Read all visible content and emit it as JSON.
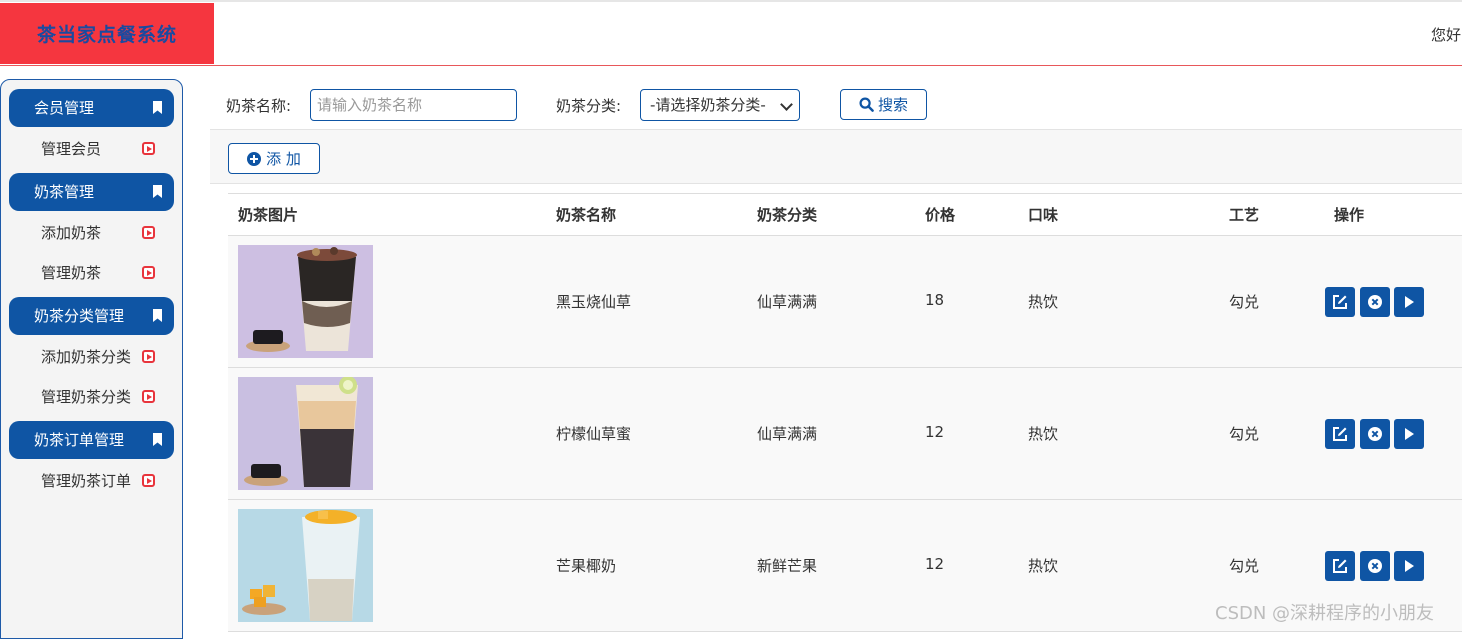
{
  "app": {
    "title": "茶当家点餐系统",
    "greeting": "您好"
  },
  "sidebar": {
    "groups": [
      {
        "title": "会员管理",
        "items": [
          "管理会员"
        ]
      },
      {
        "title": "奶茶管理",
        "items": [
          "添加奶茶",
          "管理奶茶"
        ]
      },
      {
        "title": "奶茶分类管理",
        "items": [
          "添加奶茶分类",
          "管理奶茶分类"
        ]
      },
      {
        "title": "奶茶订单管理",
        "items": [
          "管理奶茶订单"
        ]
      }
    ]
  },
  "search": {
    "name_label": "奶茶名称:",
    "name_placeholder": "请输入奶茶名称",
    "category_label": "奶茶分类:",
    "category_selected": "-请选择奶茶分类-",
    "search_button": "搜索"
  },
  "toolbar": {
    "add_button": "添 加"
  },
  "table": {
    "headers": [
      "奶茶图片",
      "奶茶名称",
      "奶茶分类",
      "价格",
      "口味",
      "工艺",
      "操作"
    ],
    "rows": [
      {
        "name": "黑玉烧仙草",
        "category": "仙草满满",
        "price": "18",
        "taste": "热饮",
        "craft": "勾兑"
      },
      {
        "name": "柠檬仙草蜜",
        "category": "仙草满满",
        "price": "12",
        "taste": "热饮",
        "craft": "勾兑"
      },
      {
        "name": "芒果椰奶",
        "category": "新鲜芒果",
        "price": "12",
        "taste": "热饮",
        "craft": "勾兑"
      }
    ]
  },
  "icons": {
    "bookmark": "bookmark-icon",
    "play": "play-square-icon",
    "search": "search-icon",
    "add": "plus-circle-icon",
    "edit": "edit-icon",
    "delete": "close-circle-icon",
    "detail": "play-icon"
  },
  "colors": {
    "brand_red": "#f5363f",
    "primary_blue": "#0f55a4",
    "logo_text": "#1a4aa0"
  },
  "watermark": "CSDN @深耕程序的小朋友"
}
